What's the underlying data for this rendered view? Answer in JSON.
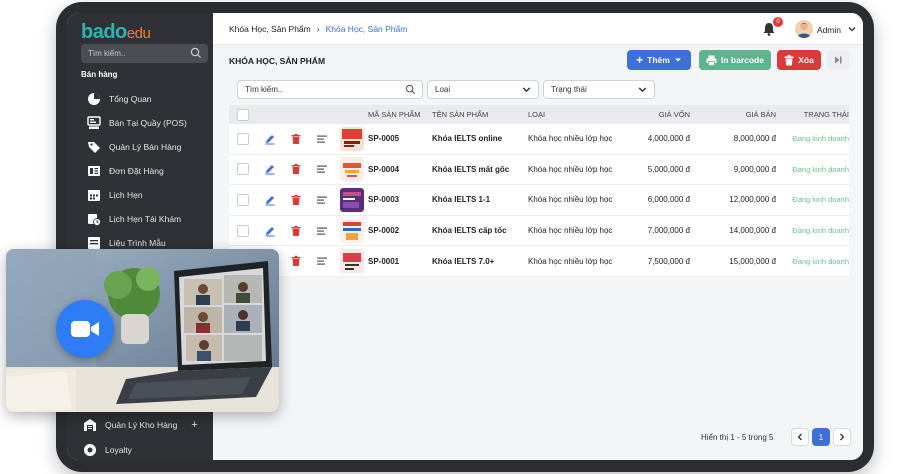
{
  "brand": {
    "name_part1": "bado",
    "name_part2": "edu"
  },
  "sidebar": {
    "search_placeholder": "Tìm kiếm..",
    "section": "Bán hàng",
    "items": [
      {
        "label": "Tổng Quan",
        "icon": "dashboard-icon"
      },
      {
        "label": "Bán Tại Quầy (POS)",
        "icon": "pos-icon"
      },
      {
        "label": "Quản Lý Bán Hàng",
        "icon": "tag-icon"
      },
      {
        "label": "Đơn Đặt Hàng",
        "icon": "order-icon"
      },
      {
        "label": "Lịch Hẹn",
        "icon": "calendar-icon"
      },
      {
        "label": "Lịch Hẹn Tái Khám",
        "icon": "calendar-clock-icon"
      },
      {
        "label": "Liệu Trình Mẫu",
        "icon": "template-icon"
      }
    ],
    "bottom_items": [
      {
        "label": "Quản Lý Kho Hàng",
        "icon": "warehouse-icon"
      },
      {
        "label": "Loyalty",
        "icon": "loyalty-icon"
      }
    ]
  },
  "header": {
    "breadcrumb": [
      "Khóa Học, Sản Phẩm",
      "Khóa Học, Sản Phẩm"
    ],
    "notification_count": "0",
    "user_name": "Admin"
  },
  "page": {
    "title": "KHÓA HỌC, SẢN PHẨM",
    "add_label": "Thêm",
    "print_label": "In barcode",
    "delete_label": "Xóa"
  },
  "filters": {
    "search_placeholder": "Tìm kiếm..",
    "type_placeholder": "Loại",
    "status_placeholder": "Trạng thái"
  },
  "table": {
    "columns": [
      "MÃ SẢN PHẨM",
      "TÊN SẢN PHẨM",
      "LOẠI",
      "GIÁ VỐN",
      "GIÁ BÁN",
      "TRẠNG THÁI"
    ],
    "rows": [
      {
        "code": "SP-0005",
        "name": "Khóa IELTS online",
        "type": "Khóa học nhiều lớp học",
        "cost": "4,000,000 đ",
        "price": "8,000,000 đ",
        "status": "Đang kinh doanh"
      },
      {
        "code": "SP-0004",
        "name": "Khóa IELTS mất gốc",
        "type": "Khóa học nhiều lớp học",
        "cost": "5,000,000 đ",
        "price": "9,000,000 đ",
        "status": "Đang kinh doanh"
      },
      {
        "code": "SP-0003",
        "name": "Khóa IELTS 1-1",
        "type": "Khóa học nhiều lớp học",
        "cost": "6,000,000 đ",
        "price": "12,000,000 đ",
        "status": "Đang kinh doanh"
      },
      {
        "code": "SP-0002",
        "name": "Khóa IELTS cấp tốc",
        "type": "Khóa học nhiều lớp học",
        "cost": "7,000,000 đ",
        "price": "14,000,000 đ",
        "status": "Đang kinh doanh"
      },
      {
        "code": "SP-0001",
        "name": "Khóa IELTS 7.0+",
        "type": "Khóa học nhiều lớp học",
        "cost": "7,500,000 đ",
        "price": "15,000,000 đ",
        "status": "Đang kinh doanh"
      }
    ]
  },
  "pagination": {
    "summary": "Hiển thị 1 - 5 trong 5",
    "current_page": "1"
  },
  "colors": {
    "primary": "#3f6fd8",
    "success": "#5fb38d",
    "danger": "#d93a3a",
    "status_text": "#6fbf8f",
    "sidebar_bg": "#2f3136",
    "video_button": "#2e7cf6"
  }
}
